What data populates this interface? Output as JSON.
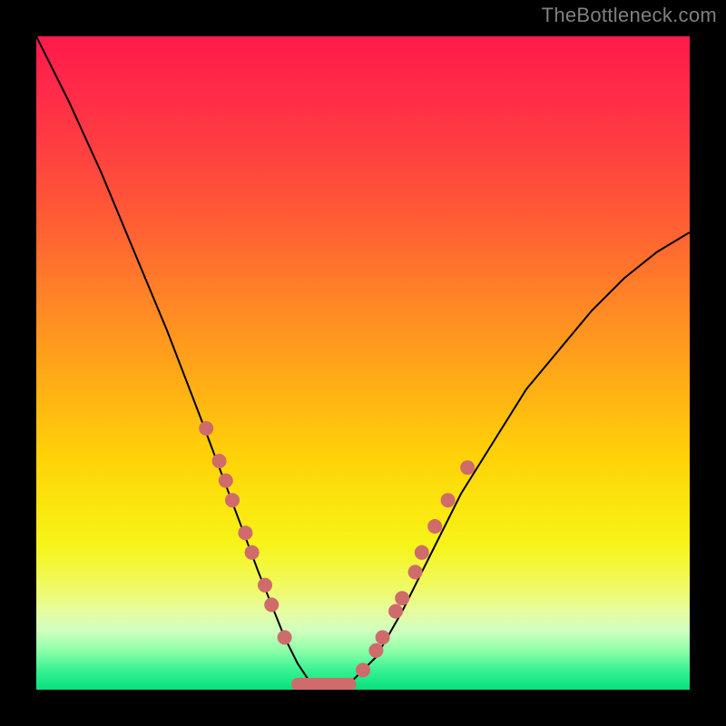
{
  "attribution": "TheBottleneck.com",
  "colors": {
    "page_bg": "#000000",
    "watermark": "#808080",
    "curve": "#000000",
    "marker": "#cf6b6b"
  },
  "chart_data": {
    "type": "line",
    "title": "",
    "xlabel": "",
    "ylabel": "",
    "xlim": [
      0,
      100
    ],
    "ylim": [
      0,
      100
    ],
    "series": [
      {
        "name": "bottleneck-curve",
        "x": [
          0,
          5,
          10,
          15,
          20,
          25,
          28,
          31,
          34,
          36,
          38,
          40,
          42,
          44,
          46,
          48,
          52,
          56,
          60,
          65,
          70,
          75,
          80,
          85,
          90,
          95,
          100
        ],
        "y": [
          100,
          90,
          79,
          67,
          55,
          42,
          34,
          26,
          18,
          13,
          8,
          4,
          1,
          0,
          0,
          1,
          5,
          12,
          20,
          30,
          38,
          46,
          52,
          58,
          63,
          67,
          70
        ]
      }
    ],
    "markers_left": [
      {
        "x": 26,
        "y": 40
      },
      {
        "x": 28,
        "y": 35
      },
      {
        "x": 29,
        "y": 32
      },
      {
        "x": 30,
        "y": 29
      },
      {
        "x": 32,
        "y": 24
      },
      {
        "x": 33,
        "y": 21
      },
      {
        "x": 35,
        "y": 16
      },
      {
        "x": 36,
        "y": 13
      },
      {
        "x": 38,
        "y": 8
      }
    ],
    "markers_right": [
      {
        "x": 50,
        "y": 3
      },
      {
        "x": 52,
        "y": 6
      },
      {
        "x": 53,
        "y": 8
      },
      {
        "x": 55,
        "y": 12
      },
      {
        "x": 56,
        "y": 14
      },
      {
        "x": 58,
        "y": 18
      },
      {
        "x": 59,
        "y": 21
      },
      {
        "x": 61,
        "y": 25
      },
      {
        "x": 63,
        "y": 29
      },
      {
        "x": 66,
        "y": 34
      }
    ],
    "trough_band": {
      "x_start": 40,
      "x_end": 48,
      "y": 0
    }
  }
}
